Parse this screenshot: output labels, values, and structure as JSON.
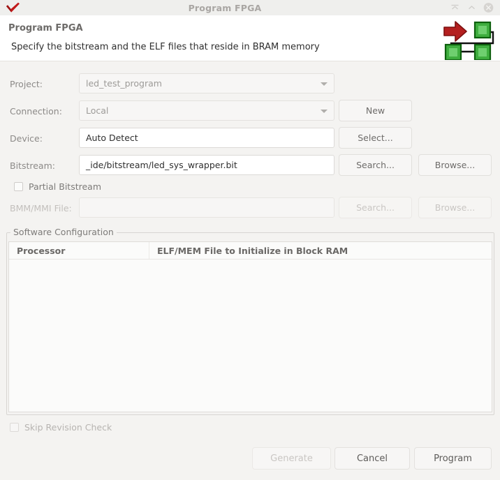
{
  "window": {
    "title": "Program FPGA",
    "app_icon": "red-check-logo-icon",
    "controls": [
      {
        "name": "minimize-button",
        "icon": "minimize-icon"
      },
      {
        "name": "maximize-button",
        "icon": "chevron-up-icon"
      },
      {
        "name": "close-button",
        "icon": "close-circle-icon"
      }
    ]
  },
  "header": {
    "title": "Program FPGA",
    "subtitle": "Specify the bitstream and the ELF files that reside in BRAM memory",
    "logo": "fpga-chain-icon"
  },
  "form": {
    "project": {
      "label": "Project:",
      "value": "led_test_program",
      "enabled": false
    },
    "connection": {
      "label": "Connection:",
      "value": "Local",
      "enabled": false,
      "new_button": "New"
    },
    "device": {
      "label": "Device:",
      "value": "Auto Detect",
      "enabled": true,
      "select_button": "Select..."
    },
    "bitstream": {
      "label": "Bitstream:",
      "value": "_ide/bitstream/led_sys_wrapper.bit",
      "enabled": true,
      "search_button": "Search...",
      "browse_button": "Browse..."
    },
    "partial_bitstream": {
      "label": "Partial Bitstream",
      "checked": false
    },
    "bmm_mmi": {
      "label": "BMM/MMI File:",
      "value": "",
      "enabled": false,
      "search_button": "Search...",
      "browse_button": "Browse..."
    }
  },
  "software_configuration": {
    "group_title": "Software Configuration",
    "columns": [
      "Processor",
      "ELF/MEM File to Initialize in Block RAM"
    ],
    "rows": []
  },
  "skip_revision_check": {
    "label": "Skip Revision Check",
    "checked": false
  },
  "footer": {
    "generate": "Generate",
    "cancel": "Cancel",
    "program": "Program"
  },
  "colors": {
    "window_bg": "#f4f3f1",
    "titlebar_bg": "#efefed",
    "header_bg": "#ffffff",
    "accent_red": "#b41f1f",
    "accent_green": "#2f9e2f",
    "label_gray": "#8c8a88",
    "disabled_gray": "#c3c0bd"
  }
}
